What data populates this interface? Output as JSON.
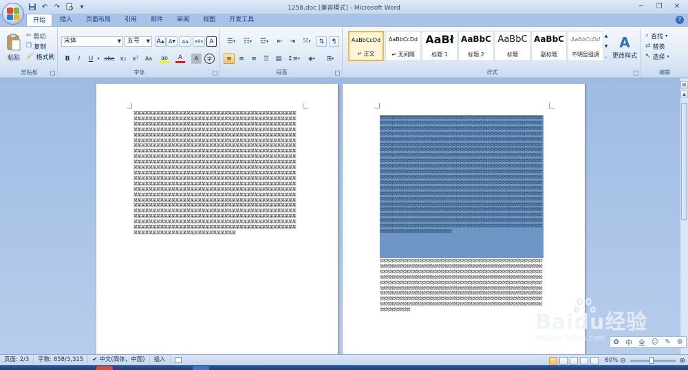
{
  "window": {
    "title": "1258.doc [兼容模式] - Microsoft Word",
    "minimize": "─",
    "maximize": "❐",
    "close": "✕"
  },
  "qat": {
    "save_icon": "save-icon",
    "undo_icon": "undo-icon",
    "redo_icon": "redo-icon",
    "print_preview_icon": "print-preview-icon",
    "customize_icon": "dropdown-icon"
  },
  "tabs": [
    {
      "label": "开始",
      "active": true
    },
    {
      "label": "插入"
    },
    {
      "label": "页面布局"
    },
    {
      "label": "引用"
    },
    {
      "label": "邮件"
    },
    {
      "label": "审阅"
    },
    {
      "label": "视图"
    },
    {
      "label": "开发工具"
    }
  ],
  "help": "?",
  "clipboard": {
    "label": "剪贴板",
    "paste": "粘贴",
    "cut": "剪切",
    "copy": "复制",
    "format_painter": "格式刷"
  },
  "font": {
    "label": "字体",
    "font_name": "宋体",
    "font_size": "五号",
    "grow": "A",
    "shrink": "A",
    "clear": "Aa",
    "phonetic": "wén",
    "border": "A",
    "bold": "B",
    "italic": "I",
    "underline": "U",
    "strike": "abe",
    "subscript": "x₂",
    "superscript": "x²",
    "change_case": "Aa",
    "highlight": "ab",
    "font_color": "A",
    "shading": "A",
    "enclose": "字"
  },
  "paragraph": {
    "label": "段落"
  },
  "styles": {
    "label": "样式",
    "items": [
      {
        "sample": "AaBbCcDd",
        "name": "↵ 正文",
        "selected": true
      },
      {
        "sample": "AaBbCcDd",
        "name": "↵ 无间隔"
      },
      {
        "sample": "AaBł",
        "name": "标题 1"
      },
      {
        "sample": "AaBbC",
        "name": "标题 2"
      },
      {
        "sample": "AaBbC",
        "name": "标题"
      },
      {
        "sample": "AaBbC",
        "name": "副标题"
      },
      {
        "sample": "AaBbCcDd",
        "name": "不明显强调"
      }
    ],
    "change_styles": "更改样式"
  },
  "editing": {
    "label": "编辑",
    "find": "查找",
    "replace": "替换",
    "select": "选择"
  },
  "documents": {
    "page1_text": "某某某某某某某某某某某某某某某某某某某某某某某某某某某某某某某某某某某某某某某某某某某某某某某某某某某某某某某某某某某某某某某某某某某某某某某某某某某某某某某某某某某某某某某某某某某某某某某某某某某某某某某某某某某某某某某某某某某某某某某某某某某某某某某某某某某某某某某某某某某某某某某某某某某某某某某某某某某某某某某某某某某某某某某某某某某某某某某某某某某某某某某某某某某某某某某某某某某某某某某某某某某某某某某某某某某某某某某某某某某某某某某某某某某某某某某某某某某某某某某某某某某某某某某某某某某某某某某某某某某某某某某某某某某某某某某某某某某某某某某某某某某某某某某某某某某某某某某某某某某某某某某某某某某某某某某某某某某某某某某某某某某某某某某某某某某某某某某某某某某某某某某某某某某某某某某某某某某某某某某某某某某某某某某某某某某某某某某某某某某某某某某某某某某某某某某某某某某某某某某某某某某某某某某某某某某某某某某某某某某某某某某某某某某某某某某某某某某某某某某某某某某某某某某某某某某某某某某某某某某某某某某某某某某某某某某某某某某某某某某某某某某某某某某某某某某某某某某某某某某某某某某某某某某某某某某某某某某某某某某某某某某某某某某某某某某某某某某某某某某某某某某某某某某某某某某某某某某某某某某某某某某某某某某某某某某某某某某某某某某某某某某某某某某某某某某某某某某某某某某某某某某某某某某某某某某某某某某某某某某某某某某某某某某某某某某某某某某某某某某某某某某某某某某某某某某某某某某某某某某某某某某某某某某某某某某某某某某某某某某某某某某某某某某某某某某某某某某某某某某某某某某某某某某某某某某某某某某某某某某某某某某某某某某某某某某某某某某某某某某某某某某某某某某某某某某某某某某某某某某某某某某某某某某某某某某某某某某某某某某某某某某某某某某某某某某某某某某某某某某某某某某某某某某某某某某某某某某某某某某某某某某某某某某某某某某某某某某某某某某某某某某某某某某某某某某某某某某某某某某某某某某某某某某某某某某某某某某某某某某某某某某某某某某某某某某某某某某某某某某某某某某某某某某某某某某某某某某某某某某某某某某某某某某某某某某某某某某某某某某某某某某某某某某某某某某某某某某某某某某某某某某某某某某某某某某某某",
    "page2_text": "验验验验验验验验验验验验验验验验验验验验验验验验验验验验验验验验验验验验验验验验验验验验验验验验验验验验验验验验验验验验验验验验验验验验验验验验验验验验验验验验验验验验验验验验验验验验验验验验验验验验验验验验验验验验验验验验验验验验验验验验验验验验验验验验验验验验验验验验验验验验验验验验验验验验验验验验验验验验验验验验验验验验验验验验验验验验验验验验验验验验验验验验验验验验验验验验验验验验验验验验验验验验验验验验验验验验验验验验验验验验验验验验验验验验验验验验验验验验验验验验验验验验验验验验验验验验验验验验验验验验验验验验验验验验验验验验验验验验验验验验验验验验验验验验验验验验验验验验验验验验验验验验验验验验验验验验验验验验验验验验验验验验验验验验验验验验验验验验验验验验验验验验验验验验验验验验验验验验验验验验验验验验验验验验验验验验验验验验验验验验验验验验验验验验验验验验验验验验验验验验验验验验验验验验验验验验验验验验验验验验验验验验验验验验验验验验验验验验验验验验验验验验验验验验验验验验验验验验验验验验验验验验验验验验验验验验验验验验验验验验验验验验验验验验验验验验验验验验验验验验验验验验验验验验验验验验验验验验验验验验验验验验验验验验验验验验验验验验验验验验验验验验验验验验验验验验验验验验验验验验验验验验验验验验验验验验验验验验验验验验验验验验验验验验验验验验验验验验验验验验验验验验验验验验验验验验验验验验验验验验验验验验验验验验验验验验验验验验验验验验验验验验验验验验验验验验验验验验验验验验验验验验验验验验验验验验验验验验验验验验验验验验验验验验验验验验验验验验验验验验验验验验验验验验验验验验验验验验验验验验验验验验验验验验验验验验验验验验验验验验验验验验验验验验验验验验验验验验验验验验验验验验验验验验验验验验验验验验验验验验验验验验验验验验验验验验验验验验验验验验验验验验验验验验验验验验验验验验验验验验验验验验验验验验验验验验验验验验验验验验验验验验验验验验验验验验验验验验验验验验验验验验验验验验验验验验验验验验验验验验验验验验验验验验验验验验验验验验验验验验验验验验验验验验验验验验验验验验验验验验验验",
    "page2_bottom_text": "验验验验验验验验验验验验验验验验验验验验验验验验验验验验验验验验验验验验验验验验验验验验验验验验验验验验验验验验验验验验验验验验验验验验验验验验验验验验验验验验验验验验验验验验验验验验验验验验验验验验验验验验验验验验验验验验验验验验验验验验验验验验验验验验验验验验验验验验验验验验验验验验验验验验验验验验验验验验验验验验验验验验验验验验验验验验验验验验验验验验验验验验验验验验验验验验验验验验验验验验验验验验验验验验验验验验验验验验验验验验验验验验验验验验验验验验验验验验验验验验验验验验验验验验验验验验验验验验验验验验验验验验验验验验验验验验验验验验验验验验验验验验验验验验验验验验验验验验验验验验验验验验验验验验验验验验验验验验验验验验验验验验验验验验验验验验验验验验验验验验验验验验验验验验验验验验验验验验验验验验验验验验验验验验验验验验验验验验验验验验验验验验验验验验验验验验验验验"
  },
  "watermark": {
    "brand": "Baidu经验",
    "url": "jingyan.baidu.com"
  },
  "ime": {
    "lang": "中",
    "width": "全",
    "punct": "☺",
    "pen": "✎",
    "settings": "⚙"
  },
  "statusbar": {
    "page": "页面: 2/3",
    "words": "字数: 858/3,315",
    "language": "中文(简体，中国)",
    "mode": "插入",
    "zoom": "60%",
    "zoom_out": "⊖",
    "zoom_in": "⊕"
  },
  "colors": {
    "selection": "#6f97c5",
    "ribbon_blue": "#15428b"
  }
}
